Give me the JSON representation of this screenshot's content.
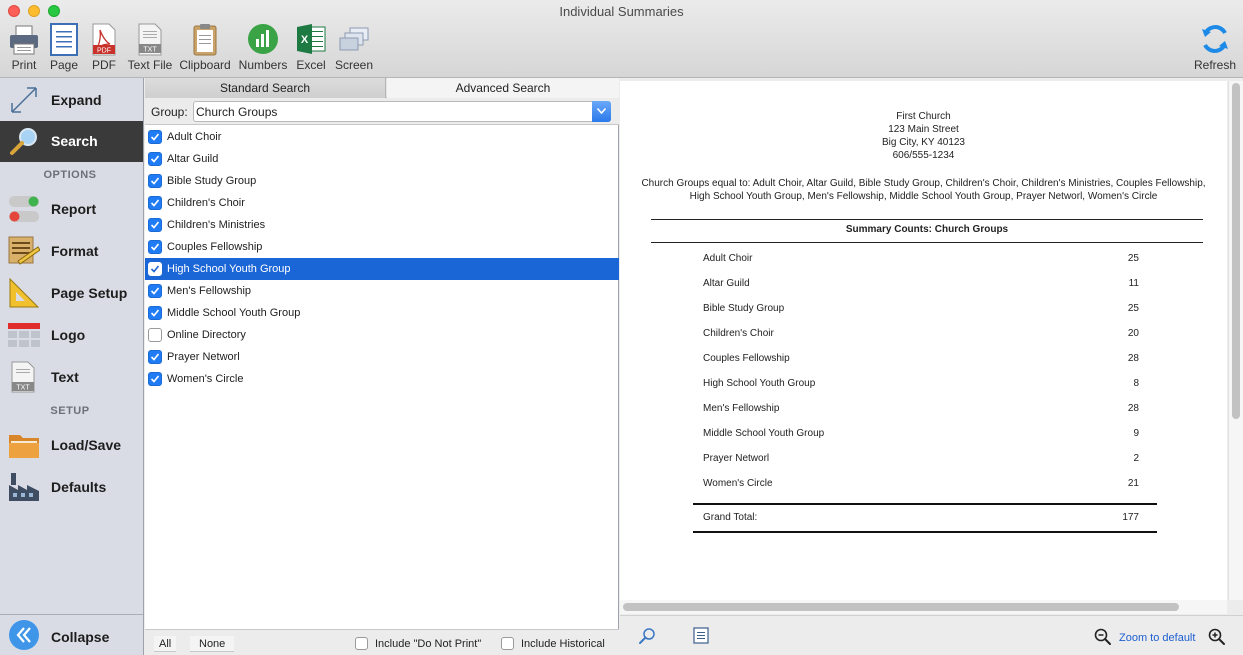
{
  "window": {
    "title": "Individual Summaries"
  },
  "toolbar": {
    "items": [
      {
        "label": "Print",
        "icon": "printer-icon"
      },
      {
        "label": "Page",
        "icon": "page-icon"
      },
      {
        "label": "PDF",
        "icon": "pdf-icon"
      },
      {
        "label": "Text File",
        "icon": "text-file-icon"
      },
      {
        "label": "Clipboard",
        "icon": "clipboard-icon"
      },
      {
        "label": "Numbers",
        "icon": "numbers-icon"
      },
      {
        "label": "Excel",
        "icon": "excel-icon"
      },
      {
        "label": "Screen",
        "icon": "screen-icon"
      }
    ],
    "refresh": {
      "label": "Refresh",
      "icon": "refresh-icon"
    }
  },
  "sidebar": {
    "expand": "Expand",
    "search": "Search",
    "options_heading": "OPTIONS",
    "report": "Report",
    "format": "Format",
    "page_setup": "Page Setup",
    "logo": "Logo",
    "text": "Text",
    "setup_heading": "SETUP",
    "load_save": "Load/Save",
    "defaults": "Defaults",
    "collapse": "Collapse"
  },
  "search": {
    "tabs": {
      "standard": "Standard Search",
      "advanced": "Advanced Search"
    },
    "group_label": "Group:",
    "group_value": "Church Groups",
    "items": [
      {
        "label": "Adult Choir",
        "checked": true
      },
      {
        "label": "Altar Guild",
        "checked": true
      },
      {
        "label": "Bible Study Group",
        "checked": true
      },
      {
        "label": "Children's Choir",
        "checked": true
      },
      {
        "label": "Children's Ministries",
        "checked": true
      },
      {
        "label": "Couples Fellowship",
        "checked": true
      },
      {
        "label": "High School Youth Group",
        "checked": true,
        "selected": true
      },
      {
        "label": "Men's Fellowship",
        "checked": true
      },
      {
        "label": "Middle School Youth Group",
        "checked": true
      },
      {
        "label": "Online Directory",
        "checked": false
      },
      {
        "label": "Prayer Networl",
        "checked": true
      },
      {
        "label": "Women's Circle",
        "checked": true
      }
    ],
    "footer": {
      "all": "All",
      "none": "None",
      "do_not_print": "Include \"Do Not Print\"",
      "historical": "Include Historical"
    }
  },
  "report": {
    "org_name": "First Church",
    "address1": "123 Main Street",
    "address2": "Big City, KY  40123",
    "phone": "606/555-1234",
    "criteria_line1": "Church Groups equal to: Adult Choir, Altar Guild, Bible Study Group, Children's Choir, Children's Ministries, Couples Fellowship,",
    "criteria_line2": "High School Youth Group, Men's Fellowship, Middle School Youth Group, Prayer Networl, Women's Circle",
    "summary_title": "Summary Counts: Church Groups",
    "rows": [
      {
        "name": "Adult Choir",
        "count": "25"
      },
      {
        "name": "Altar Guild",
        "count": "11"
      },
      {
        "name": "Bible Study Group",
        "count": "25"
      },
      {
        "name": "Children's Choir",
        "count": "20"
      },
      {
        "name": "Couples Fellowship",
        "count": "28"
      },
      {
        "name": "High School Youth Group",
        "count": "8"
      },
      {
        "name": "Men's Fellowship",
        "count": "28"
      },
      {
        "name": "Middle School Youth Group",
        "count": "9"
      },
      {
        "name": "Prayer Networl",
        "count": "2"
      },
      {
        "name": "Women's Circle",
        "count": "21"
      }
    ],
    "grand_total_label": "Grand Total:",
    "grand_total": "177"
  },
  "preview_footer": {
    "zoom_default": "Zoom to default"
  },
  "colors": {
    "accent": "#1b66d6",
    "sidebar_bg": "#d9dce4",
    "active_item": "#3a3a3a"
  }
}
